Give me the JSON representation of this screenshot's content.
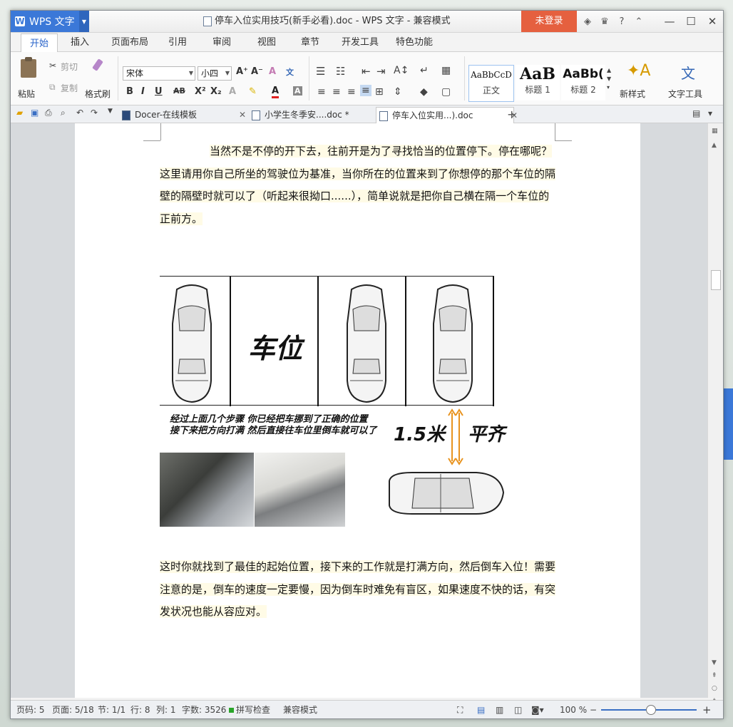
{
  "window": {
    "app_name": "WPS 文字",
    "title": "停车入位实用技巧(新手必看).doc - WPS 文字 - 兼容模式",
    "login": "未登录",
    "help": "?"
  },
  "menu": {
    "tabs": [
      "开始",
      "插入",
      "页面布局",
      "引用",
      "审阅",
      "视图",
      "章节",
      "开发工具",
      "特色功能"
    ]
  },
  "ribbon": {
    "paste": "粘贴",
    "cut": "剪切",
    "copy": "复制",
    "format_painter": "格式刷",
    "font_name": "宋体",
    "font_size": "小四",
    "styles": [
      {
        "preview": "AaBbCcD",
        "name": "正文"
      },
      {
        "preview": "AaB",
        "name": "标题 1"
      },
      {
        "preview": "AaBb(",
        "name": "标题 2"
      }
    ],
    "new_style": "新样式",
    "text_tools": "文字工具"
  },
  "doc_tabs": [
    {
      "label": "Docer-在线模板"
    },
    {
      "label": "小学生冬季安....doc *"
    },
    {
      "label": "停车入位实用...).doc"
    }
  ],
  "document": {
    "para1": "当然不是不停的开下去，往前开是为了寻找恰当的位置停下。停在哪呢？这里请用你自己所坐的驾驶位为基准，当你所在的位置来到了你想停的那个车位的隔壁的隔壁时就可以了（听起来很拗口......），简单说就是把你自己横在隔一个车位的正前方。",
    "figure": {
      "spot_label": "车位",
      "note_line1": "经过上面几个步骤 你已经把车挪到了正确的位置",
      "note_line2": "接下来把方向打满 然后直接往车位里倒车就可以了",
      "distance": "1.5米",
      "align": "平齐"
    },
    "para2": "这时你就找到了最佳的起始位置，接下来的工作就是打满方向，然后倒车入位！需要注意的是，倒车的速度一定要慢，因为倒车时难免有盲区，如果速度不快的话，有突发状况也能从容应对。"
  },
  "status": {
    "page_code": "页码: 5",
    "pages": "页面: 5/18",
    "section": "节: 1/1",
    "row": "行: 8",
    "col": "列: 1",
    "words": "字数: 3526",
    "spell": "拼写检查",
    "compat": "兼容模式",
    "zoom": "100 %"
  },
  "colors": {
    "accent": "#3b78d8",
    "login_bg": "#e5603f",
    "highlight": "#fffbe6"
  }
}
